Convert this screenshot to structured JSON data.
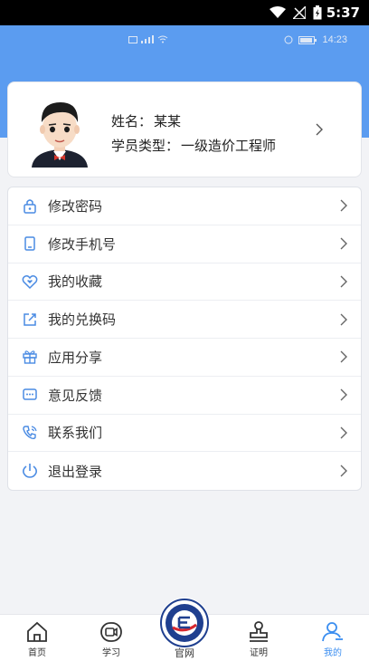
{
  "status_bar": {
    "time": "5:37"
  },
  "inner_status": {
    "time": "14:23"
  },
  "profile": {
    "name_label": "姓名：",
    "name_value": "某某",
    "type_label": "学员类型：",
    "type_value": "一级造价工程师"
  },
  "menu": [
    {
      "label": "修改密码",
      "icon": "lock-icon"
    },
    {
      "label": "修改手机号",
      "icon": "phone-icon"
    },
    {
      "label": "我的收藏",
      "icon": "heart-icon"
    },
    {
      "label": "我的兑换码",
      "icon": "share-box-icon"
    },
    {
      "label": "应用分享",
      "icon": "gift-icon"
    },
    {
      "label": "意见反馈",
      "icon": "chat-icon"
    },
    {
      "label": "联系我们",
      "icon": "call-icon"
    },
    {
      "label": "退出登录",
      "icon": "power-icon"
    }
  ],
  "tabs": [
    {
      "label": "首页",
      "icon": "home-icon"
    },
    {
      "label": "学习",
      "icon": "video-icon"
    },
    {
      "label": "官网",
      "icon": "logo-icon"
    },
    {
      "label": "证明",
      "icon": "stamp-icon"
    },
    {
      "label": "我的",
      "icon": "user-icon",
      "active": true
    }
  ],
  "colors": {
    "accent": "#3b8ef0",
    "hero": "#5b9cf0",
    "background": "#f2f3f6"
  }
}
